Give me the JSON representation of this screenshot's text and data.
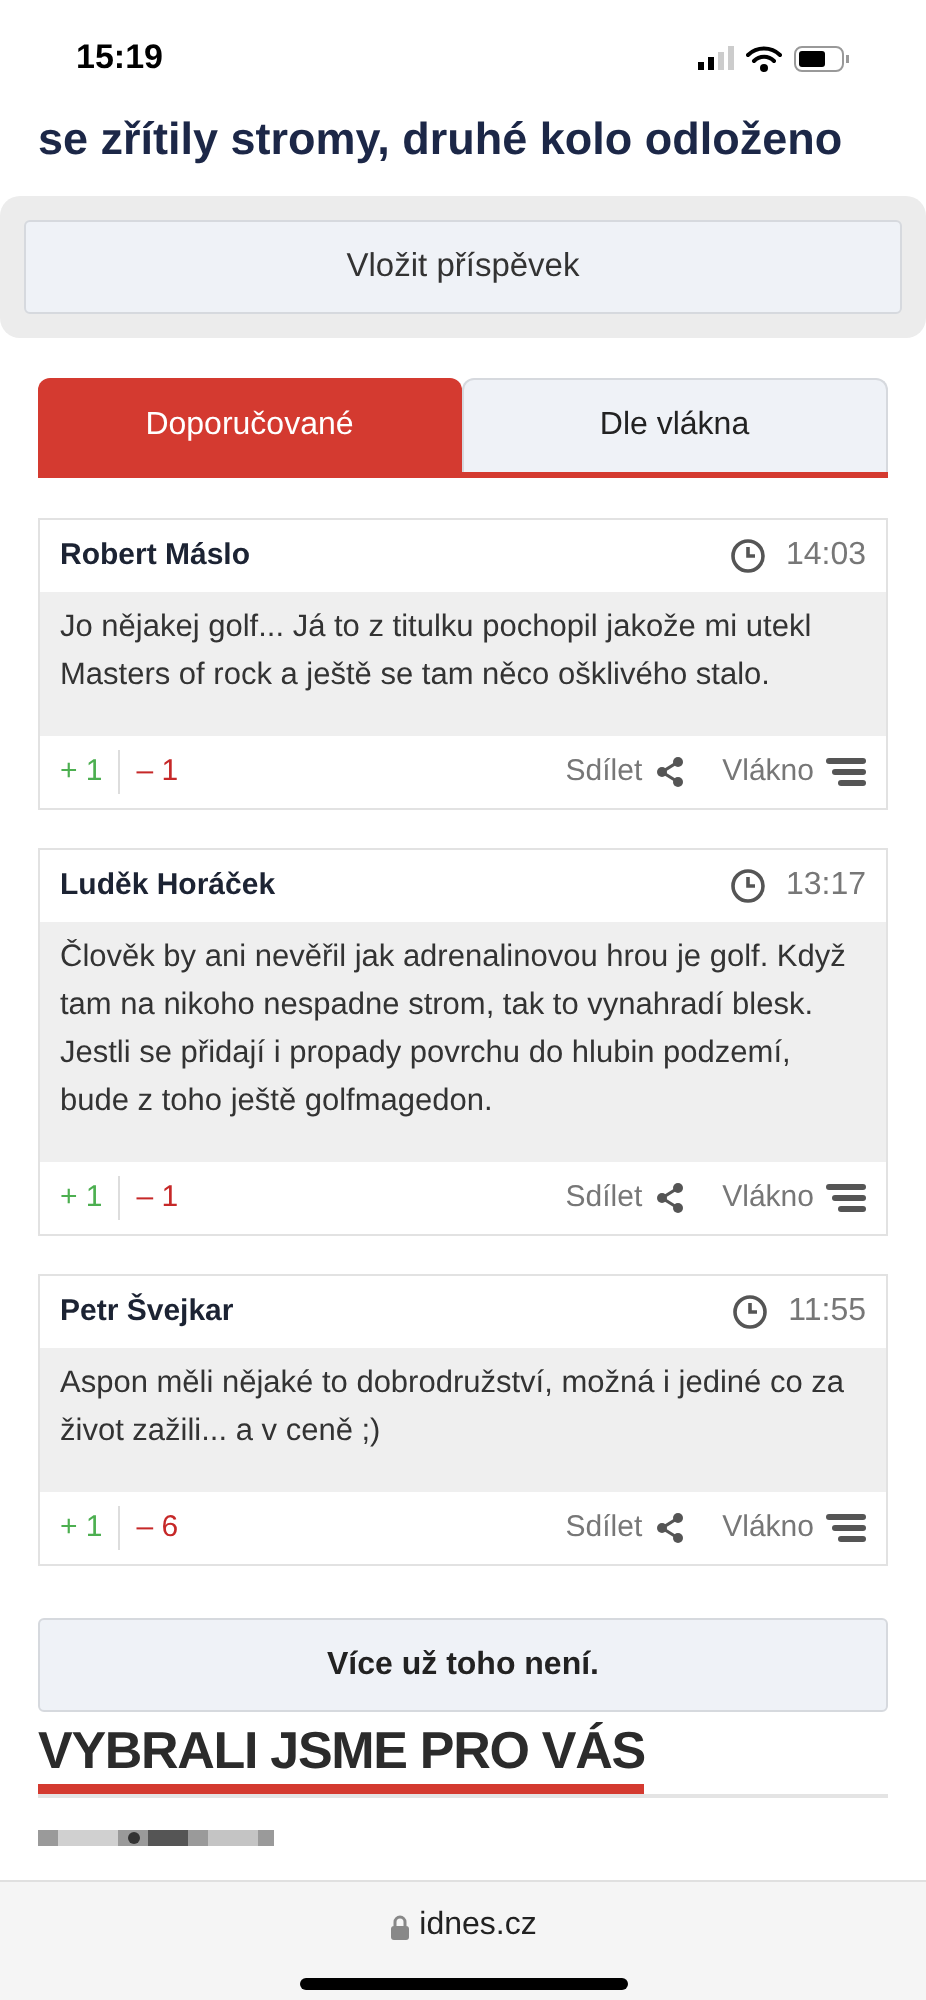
{
  "status_bar": {
    "time": "15:19"
  },
  "headline": "se zřítily stromy, druhé kolo odloženo",
  "post_button": "Vložit příspěvek",
  "tabs": [
    {
      "label": "Doporučované",
      "selected": true
    },
    {
      "label": "Dle vlákna",
      "selected": false
    }
  ],
  "comments": [
    {
      "author": "Robert Máslo",
      "time": "14:03",
      "text": "Jo nějakej golf... Já to z titulku pochopil jakože mi utekl Masters of rock a ještě se tam něco ošklivého stalo.",
      "plus": "+ 1",
      "minus": "– 1",
      "share": "Sdílet",
      "thread": "Vlákno"
    },
    {
      "author": "Luděk Horáček",
      "time": "13:17",
      "text": "Člověk by ani nevěřil jak adrenalinovou hrou je golf. Když tam na nikoho nespadne strom, tak to vynahradí blesk. Jestli se přidají i propady povrchu do hlubin podzemí, bude z toho ještě golfmagedon.",
      "plus": "+ 1",
      "minus": "– 1",
      "share": "Sdílet",
      "thread": "Vlákno"
    },
    {
      "author": "Petr Švejkar",
      "time": "11:55",
      "text": "Aspon měli nějaké to dobrodružství, možná i jediné co za život zažili... a v ceně ;)",
      "plus": "+ 1",
      "minus": "– 6",
      "share": "Sdílet",
      "thread": "Vlákno"
    }
  ],
  "more_button": "Více už toho není.",
  "section_heading": "VYBRALI JSME PRO VÁS",
  "address_bar": {
    "domain": "idnes.cz"
  }
}
